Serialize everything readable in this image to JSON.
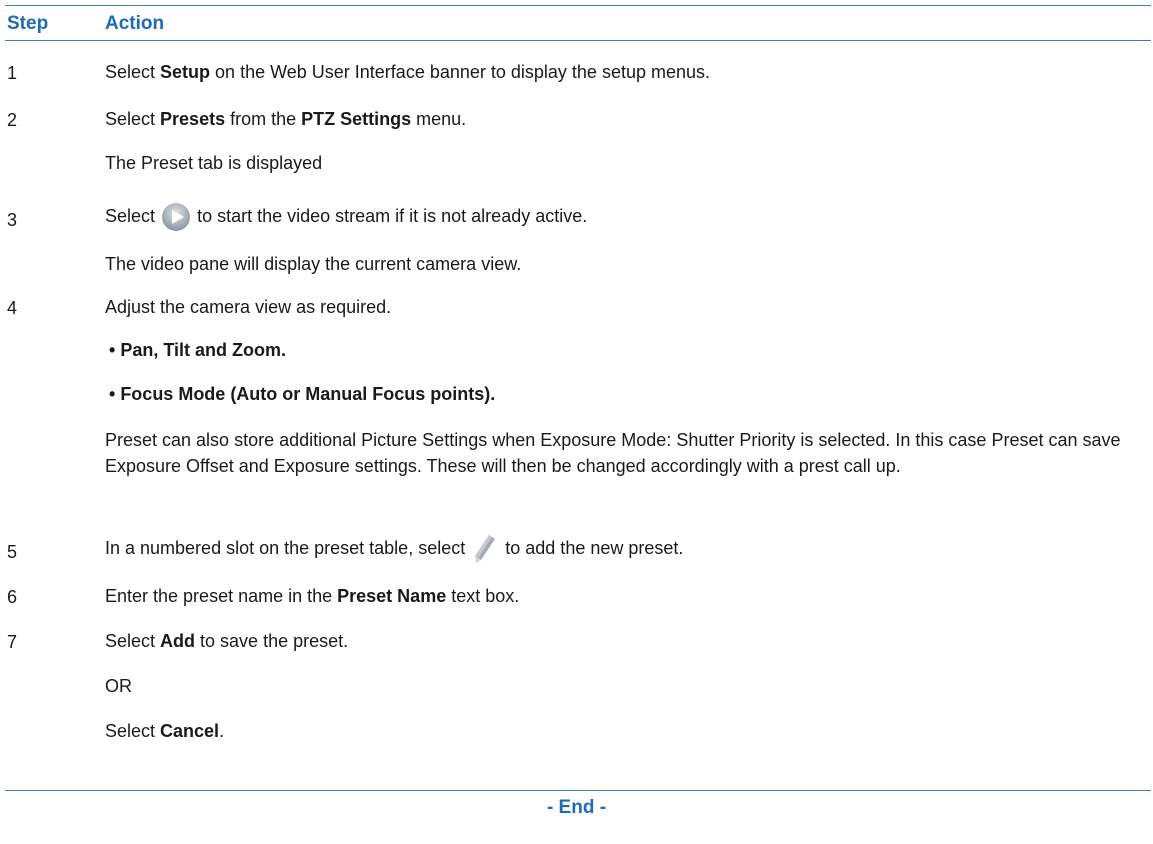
{
  "header": {
    "step": "Step",
    "action": "Action"
  },
  "steps": [
    {
      "num": "1",
      "pre": "Select ",
      "b1": "Setup",
      "post": " on the Web User Interface banner to display the setup menus."
    },
    {
      "num": "2",
      "pre": "Select ",
      "b1": "Presets",
      "mid": " from the ",
      "b2": "PTZ Settings",
      "post": " menu.",
      "note": "The Preset tab is displayed"
    },
    {
      "num": "3",
      "pre": "Select",
      "post": "to start the video stream if it is not already active.",
      "note": "The video pane will display the current camera view.",
      "icon": "play-button-icon"
    },
    {
      "num": "4",
      "text": "Adjust the camera view as required.",
      "bullets": [
        "Pan, Tilt and Zoom.",
        "Focus Mode (Auto or Manual Focus points)."
      ],
      "note": "Preset can also store additional Picture Settings when Exposure Mode: Shutter Priority is selected. In this case Preset can save Exposure Offset and Exposure settings. These will then be changed accordingly with a prest call up."
    },
    {
      "num": "5",
      "pre": "In a numbered slot on the preset table, select",
      "post": "to add the new preset.",
      "icon": "pencil-edit-icon"
    },
    {
      "num": "6",
      "pre": "Enter the preset name in the ",
      "b1": "Preset Name",
      "post": " text box."
    },
    {
      "num": "7",
      "pre": "Select ",
      "b1": "Add",
      "post": " to save the preset.",
      "or": "OR",
      "alt_pre": "Select ",
      "alt_b": "Cancel",
      "alt_post": "."
    }
  ],
  "footer": {
    "end": "- End -"
  }
}
